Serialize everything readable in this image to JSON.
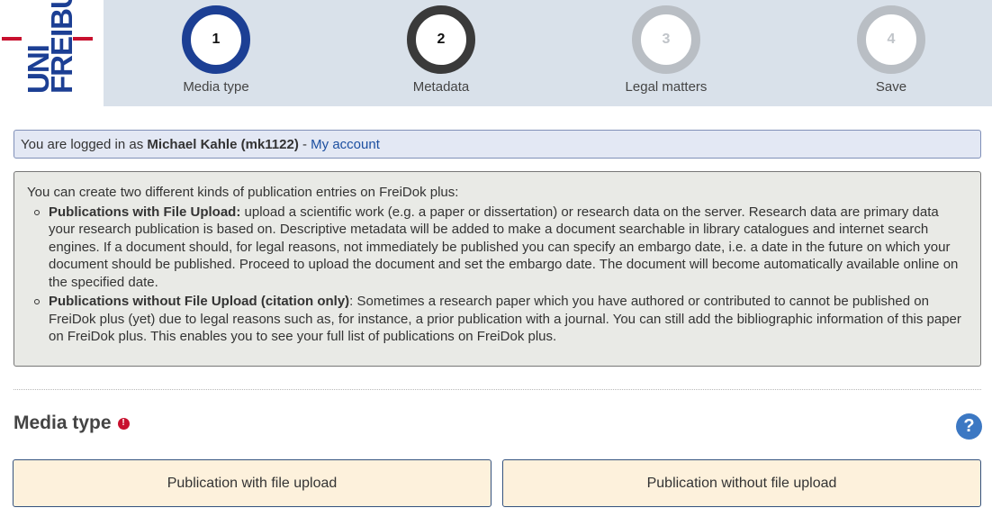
{
  "logo": {
    "line1": "UNI",
    "line2": "FREIBU"
  },
  "steps": [
    {
      "number": "1",
      "label": "Media type",
      "state": "active"
    },
    {
      "number": "2",
      "label": "Metadata",
      "state": "upcoming"
    },
    {
      "number": "3",
      "label": "Legal matters",
      "state": "disabled"
    },
    {
      "number": "4",
      "label": "Save",
      "state": "disabled"
    }
  ],
  "login": {
    "prefix": "You are logged in as",
    "user": "Michael Kahle (mk1122)",
    "separator": "-",
    "account_link": "My account"
  },
  "info": {
    "intro": "You can create two different kinds of publication entries on FreiDok plus:",
    "items": [
      {
        "title": "Publications with File Upload:",
        "text": " upload a scientific work (e.g. a paper or dissertation) or research data on the server. Research data are primary data your research publication is based on. Descriptive metadata will be added to make a document searchable in library catalogues and internet search engines. If a document should, for legal reasons, not immediately be published you can specify an embargo date, i.e. a date in the future on which your document should be published. Proceed to upload the document and set the embargo date. The document will become automatically available online on the specified date."
      },
      {
        "title": "Publications without File Upload (citation only)",
        "text": ": Sometimes a research paper which you have authored or contributed to cannot be published on FreiDok plus (yet) due to legal reasons such as, for instance, a prior publication with a journal. You can still add the bibliographic information of this paper on FreiDok plus. This enables you to see your full list of publications on FreiDok plus."
      }
    ]
  },
  "section": {
    "title": "Media type",
    "required_icon": "!",
    "help_icon": "?"
  },
  "buttons": {
    "with_upload": "Publication with file upload",
    "without_upload": "Publication without file upload"
  },
  "colors": {
    "brand_blue": "#1c3f94",
    "brand_red": "#c8102e",
    "header_bg": "#d9e1ea",
    "button_bg": "#fdf1dc"
  }
}
